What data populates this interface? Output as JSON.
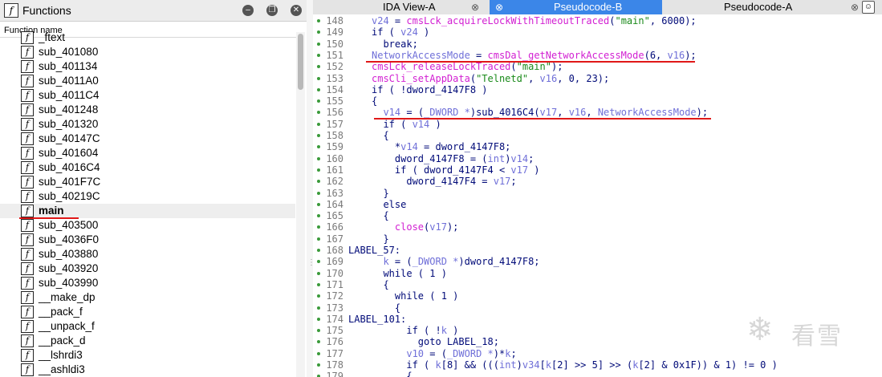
{
  "left_panel": {
    "title": "Functions",
    "icon": "function-icon",
    "column_header": "Function name",
    "controls": [
      "minimize-icon",
      "maximize-icon",
      "close-icon"
    ],
    "functions": [
      "_ftext",
      "sub_401080",
      "sub_401134",
      "sub_4011A0",
      "sub_4011C4",
      "sub_401248",
      "sub_401320",
      "sub_40147C",
      "sub_401604",
      "sub_4016C4",
      "sub_401F7C",
      "sub_40219C",
      "main",
      "sub_403500",
      "sub_4036F0",
      "sub_403880",
      "sub_403920",
      "sub_403990",
      "__make_dp",
      "__pack_f",
      "__unpack_f",
      "__pack_d",
      "__lshrdi3",
      "__ashldi3"
    ],
    "selected": "main"
  },
  "tabs": [
    {
      "label": "IDA View-A",
      "close": "⊗"
    },
    {
      "label": "Pseudocode-B",
      "close": "⊗"
    },
    {
      "label": "Pseudocode-A",
      "close": "⊗"
    }
  ],
  "watermark": "看雪",
  "code": [
    {
      "n": "148",
      "t": [
        [
          "v",
          "v24"
        ],
        [
          "k",
          " = "
        ],
        [
          "f",
          "cmsLck_acquireLockWithTimeoutTraced"
        ],
        [
          "k",
          "("
        ],
        [
          "s",
          "\"main\""
        ],
        [
          "k",
          ", 6000);"
        ]
      ]
    },
    {
      "n": "149",
      "t": [
        [
          "k",
          "if ( "
        ],
        [
          "v",
          "v24"
        ],
        [
          "k",
          " )"
        ]
      ]
    },
    {
      "n": "150",
      "t": [
        [
          "k",
          "  break;"
        ]
      ]
    },
    {
      "n": "151",
      "t": [
        [
          "v",
          "NetworkAccessMode"
        ],
        [
          "k",
          " = "
        ],
        [
          "f",
          "cmsDal_getNetworkAccessMode"
        ],
        [
          "k",
          "(6, "
        ],
        [
          "v",
          "v16"
        ],
        [
          "k",
          ");"
        ]
      ]
    },
    {
      "n": "152",
      "t": [
        [
          "f",
          "cmsLck_releaseLockTraced"
        ],
        [
          "k",
          "("
        ],
        [
          "s",
          "\"main\""
        ],
        [
          "k",
          ");"
        ]
      ]
    },
    {
      "n": "153",
      "t": [
        [
          "f",
          "cmsCli_setAppData"
        ],
        [
          "k",
          "("
        ],
        [
          "s",
          "\"Telnetd\""
        ],
        [
          "k",
          ", "
        ],
        [
          "v",
          "v16"
        ],
        [
          "k",
          ", 0, 23);"
        ]
      ]
    },
    {
      "n": "154",
      "t": [
        [
          "k",
          "if ( !dword_4147F8 )"
        ]
      ]
    },
    {
      "n": "155",
      "t": [
        [
          "k",
          "{"
        ]
      ]
    },
    {
      "n": "156",
      "t": [
        [
          "k",
          "  "
        ],
        [
          "v",
          "v14"
        ],
        [
          "k",
          " = ("
        ],
        [
          "v",
          "_DWORD *"
        ],
        [
          "k",
          ")sub_4016C4("
        ],
        [
          "v",
          "v17"
        ],
        [
          "k",
          ", "
        ],
        [
          "v",
          "v16"
        ],
        [
          "k",
          ", "
        ],
        [
          "v",
          "NetworkAccessMode"
        ],
        [
          "k",
          ");"
        ]
      ]
    },
    {
      "n": "157",
      "t": [
        [
          "k",
          "  if ( "
        ],
        [
          "v",
          "v14"
        ],
        [
          "k",
          " )"
        ]
      ]
    },
    {
      "n": "158",
      "t": [
        [
          "k",
          "  {"
        ]
      ]
    },
    {
      "n": "159",
      "t": [
        [
          "k",
          "    *"
        ],
        [
          "v",
          "v14"
        ],
        [
          "k",
          " = dword_4147F8;"
        ]
      ]
    },
    {
      "n": "160",
      "t": [
        [
          "k",
          "    dword_4147F8 = ("
        ],
        [
          "v",
          "int"
        ],
        [
          "k",
          ")"
        ],
        [
          "v",
          "v14"
        ],
        [
          "k",
          ";"
        ]
      ]
    },
    {
      "n": "161",
      "t": [
        [
          "k",
          "    if ( dword_4147F4 < "
        ],
        [
          "v",
          "v17"
        ],
        [
          "k",
          " )"
        ]
      ]
    },
    {
      "n": "162",
      "t": [
        [
          "k",
          "      dword_4147F4 = "
        ],
        [
          "v",
          "v17"
        ],
        [
          "k",
          ";"
        ]
      ]
    },
    {
      "n": "163",
      "t": [
        [
          "k",
          "  }"
        ]
      ]
    },
    {
      "n": "164",
      "t": [
        [
          "k",
          "  else"
        ]
      ]
    },
    {
      "n": "165",
      "t": [
        [
          "k",
          "  {"
        ]
      ]
    },
    {
      "n": "166",
      "t": [
        [
          "k",
          "    "
        ],
        [
          "f",
          "close"
        ],
        [
          "k",
          "("
        ],
        [
          "v",
          "v17"
        ],
        [
          "k",
          ");"
        ]
      ]
    },
    {
      "n": "167",
      "t": [
        [
          "k",
          "  }"
        ]
      ]
    },
    {
      "n": "168",
      "t": [
        [
          "k",
          "LABEL_57:"
        ]
      ],
      "label": true
    },
    {
      "n": "169",
      "t": [
        [
          "k",
          "  "
        ],
        [
          "v",
          "k"
        ],
        [
          "k",
          " = ("
        ],
        [
          "v",
          "_DWORD *"
        ],
        [
          "k",
          ")dword_4147F8;"
        ]
      ]
    },
    {
      "n": "170",
      "t": [
        [
          "k",
          "  while ( 1 )"
        ]
      ]
    },
    {
      "n": "171",
      "t": [
        [
          "k",
          "  {"
        ]
      ]
    },
    {
      "n": "172",
      "t": [
        [
          "k",
          "    while ( 1 )"
        ]
      ]
    },
    {
      "n": "173",
      "t": [
        [
          "k",
          "    {"
        ]
      ]
    },
    {
      "n": "174",
      "t": [
        [
          "k",
          "LABEL_101:"
        ]
      ],
      "label": true
    },
    {
      "n": "175",
      "t": [
        [
          "k",
          "      if ( !"
        ],
        [
          "v",
          "k"
        ],
        [
          "k",
          " )"
        ]
      ]
    },
    {
      "n": "176",
      "t": [
        [
          "k",
          "        goto LABEL_18;"
        ]
      ]
    },
    {
      "n": "177",
      "t": [
        [
          "k",
          "      "
        ],
        [
          "v",
          "v10"
        ],
        [
          "k",
          " = ("
        ],
        [
          "v",
          "_DWORD *"
        ],
        [
          "k",
          ")*"
        ],
        [
          "v",
          "k"
        ],
        [
          "k",
          ";"
        ]
      ]
    },
    {
      "n": "178",
      "t": [
        [
          "k",
          "      if ( "
        ],
        [
          "v",
          "k"
        ],
        [
          "k",
          "[8] && ((("
        ],
        [
          "v",
          "int"
        ],
        [
          "k",
          ")"
        ],
        [
          "v",
          "v34"
        ],
        [
          "k",
          "["
        ],
        [
          "v",
          "k"
        ],
        [
          "k",
          "[2] >> 5] >> ("
        ],
        [
          "v",
          "k"
        ],
        [
          "k",
          "[2] & 0x1F)) & 1) != 0 )"
        ]
      ]
    },
    {
      "n": "179",
      "t": [
        [
          "k",
          "      {"
        ]
      ]
    }
  ]
}
